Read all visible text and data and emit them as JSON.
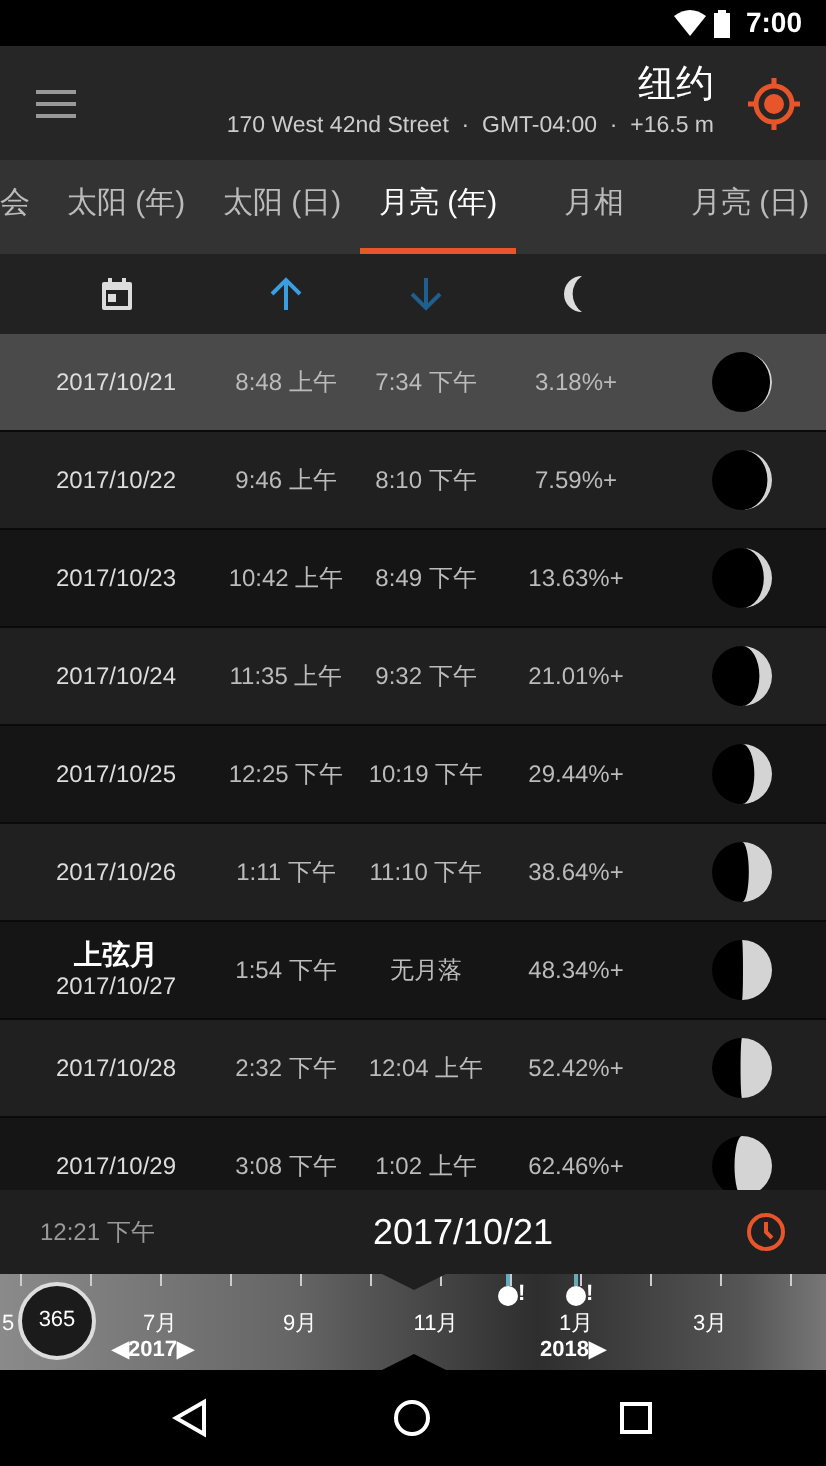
{
  "status_bar": {
    "time": "7:00"
  },
  "header": {
    "title": "纽约",
    "subtitle": "170 West 42nd Street  ·  GMT-04:00  ·  +16.5 m"
  },
  "tabs": [
    {
      "label": "会",
      "selected": false
    },
    {
      "label": "太阳 (年)",
      "selected": false
    },
    {
      "label": "太阳 (日)",
      "selected": false
    },
    {
      "label": "月亮 (年)",
      "selected": true
    },
    {
      "label": "月相",
      "selected": false
    },
    {
      "label": "月亮 (日)",
      "selected": false
    }
  ],
  "rows": [
    {
      "date": "2017/10/21",
      "rise": "8:48 上午",
      "set": "7:34 下午",
      "illumination": "3.18%+",
      "selected": true
    },
    {
      "date": "2017/10/22",
      "rise": "9:46 上午",
      "set": "8:10 下午",
      "illumination": "7.59%+",
      "selected": false
    },
    {
      "date": "2017/10/23",
      "rise": "10:42 上午",
      "set": "8:49 下午",
      "illumination": "13.63%+",
      "selected": false
    },
    {
      "date": "2017/10/24",
      "rise": "11:35 上午",
      "set": "9:32 下午",
      "illumination": "21.01%+",
      "selected": false
    },
    {
      "date": "2017/10/25",
      "rise": "12:25 下午",
      "set": "10:19 下午",
      "illumination": "29.44%+",
      "selected": false
    },
    {
      "date": "2017/10/26",
      "rise": "1:11 下午",
      "set": "11:10 下午",
      "illumination": "38.64%+",
      "selected": false
    },
    {
      "phase": "上弦月",
      "date": "2017/10/27",
      "rise": "1:54 下午",
      "set": "无月落",
      "illumination": "48.34%+",
      "selected": false
    },
    {
      "date": "2017/10/28",
      "rise": "2:32 下午",
      "set": "12:04 上午",
      "illumination": "52.42%+",
      "selected": false
    },
    {
      "date": "2017/10/29",
      "rise": "3:08 下午",
      "set": "1:02 上午",
      "illumination": "62.46%+",
      "selected": false
    }
  ],
  "footer": {
    "time": "12:21 下午",
    "date": "2017/10/21"
  },
  "timeline": {
    "edge_label": "5",
    "range": "365",
    "months": [
      "7月",
      "9月",
      "11月",
      "1月",
      "3月"
    ],
    "year_start": "◀2017▶",
    "year_end": "2018▶",
    "marker_1": "!",
    "marker_2": "!"
  }
}
